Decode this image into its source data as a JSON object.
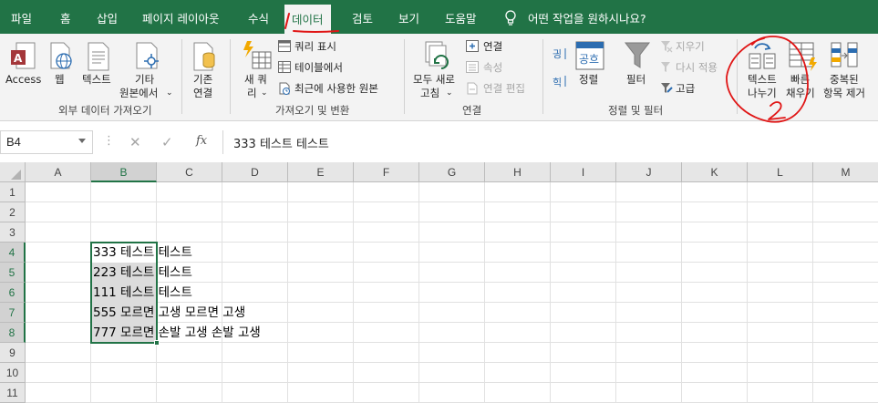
{
  "tabs": [
    {
      "label": "파일",
      "active": false
    },
    {
      "label": "홈",
      "active": false
    },
    {
      "label": "삽입",
      "active": false
    },
    {
      "label": "페이지 레이아웃",
      "active": false
    },
    {
      "label": "수식",
      "active": false
    },
    {
      "label": "데이터",
      "active": true
    },
    {
      "label": "검토",
      "active": false
    },
    {
      "label": "보기",
      "active": false
    },
    {
      "label": "도움말",
      "active": false
    }
  ],
  "tell_me": "어떤 작업을 원하시나요?",
  "ribbon": {
    "get_external": {
      "access": "Access",
      "web": "웹",
      "text": "텍스트",
      "other_line1": "기타",
      "other_line2": "원본에서",
      "group_label": "외부 데이터 가져오기"
    },
    "existing": {
      "line1": "기존",
      "line2": "연결"
    },
    "get_transform": {
      "new_query_line1": "새 쿼",
      "new_query_line2": "리",
      "show_queries": "쿼리 표시",
      "from_table": "테이블에서",
      "recent_sources": "최근에 사용한 원본",
      "group_label": "가져오기 및 변환"
    },
    "connections": {
      "refresh_line1": "모두 새로",
      "refresh_line2": "고침",
      "connections": "연결",
      "properties": "속성",
      "edit_links": "연결 편집",
      "group_label": "연결"
    },
    "sort_filter": {
      "sort": "정렬",
      "filter": "필터",
      "clear": "지우기",
      "reapply": "다시 적용",
      "advanced": "고급",
      "group_label": "정렬 및 필터",
      "sort_az_glyph": "공흐"
    },
    "data_tools": {
      "text_to_columns_line1": "텍스트",
      "text_to_columns_line2": "나누기",
      "flash_fill_line1": "빠른",
      "flash_fill_line2": "채우기",
      "remove_dup_line1": "중복된",
      "remove_dup_line2": "항목 제거"
    }
  },
  "formula_bar": {
    "name_box": "B4",
    "fx": "fx",
    "content": "333 테스트 테스트"
  },
  "grid": {
    "columns": [
      "A",
      "B",
      "C",
      "D",
      "E",
      "F",
      "G",
      "H",
      "I",
      "J",
      "K",
      "L",
      "M"
    ],
    "selected_column": "B",
    "rows": [
      "1",
      "2",
      "3",
      "4",
      "5",
      "6",
      "7",
      "8",
      "9",
      "10",
      "11"
    ],
    "selected_rows": [
      "4",
      "5",
      "6",
      "7",
      "8"
    ],
    "cells": [
      {
        "ref": "B4",
        "value": "333 테스트 테스트"
      },
      {
        "ref": "B5",
        "value": "223 테스트 테스트"
      },
      {
        "ref": "B6",
        "value": "111 테스트 테스트"
      },
      {
        "ref": "B7",
        "value": "555 모르면 고생 모르면 고생"
      },
      {
        "ref": "B8",
        "value": "777 모르면 손발 고생 손발 고생"
      }
    ]
  },
  "colors": {
    "accent": "#217346",
    "annotation": "#e01515"
  }
}
